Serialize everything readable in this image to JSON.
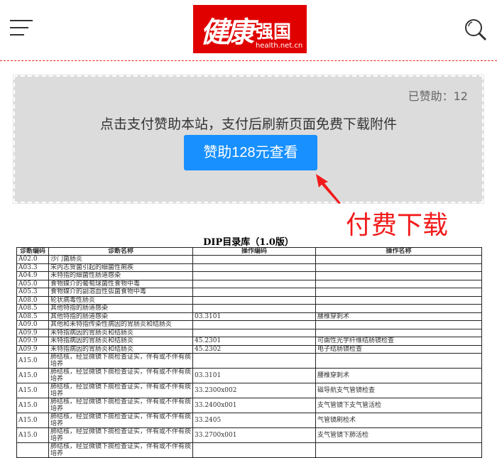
{
  "header": {
    "logo_main": "健康",
    "logo_cn": "强国",
    "logo_url": "health.net.cn"
  },
  "sponsor": {
    "count_label": "已赞助：12",
    "message": "点击支付赞助本站，支付后刷新页面免费下载附件",
    "button": "赞助128元查看",
    "annotation": "付费下载",
    "accent": "#1890ff",
    "annotation_color": "#f21a1a"
  },
  "doc": {
    "title": "DIP目录库（1.0版）",
    "headers": [
      "诊断编码",
      "诊断名称",
      "操作编码",
      "操作名称"
    ],
    "rows": [
      [
        "A02.0",
        "沙门菌肠炎",
        "",
        ""
      ],
      [
        "A03.3",
        "宋内志贺菌引起的细菌性痢疾",
        "",
        ""
      ],
      [
        "A04.9",
        "未特指的细菌性肠道感染",
        "",
        ""
      ],
      [
        "A05.0",
        "食物媒介的葡萄球菌性食物中毒",
        "",
        ""
      ],
      [
        "A05.3",
        "食物媒介的副溶血性弧菌食物中毒",
        "",
        ""
      ],
      [
        "A08.0",
        "轮状病毒性肠炎",
        "",
        ""
      ],
      [
        "A08.5",
        "其他特指的肠道感染",
        "",
        ""
      ],
      [
        "A08.5",
        "其他特指的肠道感染",
        "03.3101",
        "腰椎穿刺术"
      ],
      [
        "A09.0",
        "其他和未特指传染性病因的胃肠炎和结肠炎",
        "",
        ""
      ],
      [
        "A09.9",
        "未特指病因的胃肠炎和结肠炎",
        "",
        ""
      ],
      [
        "A09.9",
        "未特指病因的胃肠炎和结肠炎",
        "45.2301",
        "可曲性光学纤维结肠镜检查"
      ],
      [
        "A09.9",
        "未特指病因的胃肠炎和结肠炎",
        "45.2302",
        "电子结肠镜检查"
      ],
      [
        "A15.0",
        "肺结核，经显微镜下痰检查证实，伴有或不伴有痰培养",
        "",
        ""
      ],
      [
        "A15.0",
        "肺结核，经显微镜下痰检查证实，伴有或不伴有痰培养",
        "03.3101",
        "腰椎穿刺术"
      ],
      [
        "A15.0",
        "肺结核，经显微镜下痰检查证实，伴有或不伴有痰培养",
        "33.2300x002",
        "磁导航支气管镜检查"
      ],
      [
        "A15.0",
        "肺结核，经显微镜下痰检查证实，伴有或不伴有痰培养",
        "33.2400x001",
        "支气管镜下支气管活检"
      ],
      [
        "A15.0",
        "肺结核，经显微镜下痰检查证实，伴有或不伴有痰培养",
        "33.2405",
        "气管镜刷检术"
      ],
      [
        "A15.0",
        "肺结核，经显微镜下痰检查证实，伴有或不伴有痰培养",
        "33.2700x001",
        "支气管镜下肺活检"
      ],
      [
        "",
        "肺结核，经显微镜下痰检查证实，伴有或不伴有痰培养",
        "",
        ""
      ]
    ]
  }
}
